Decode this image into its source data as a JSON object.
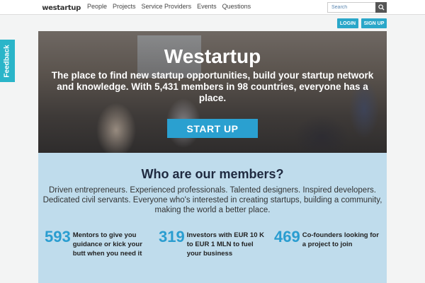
{
  "nav": {
    "logo_text": "westartup",
    "links": [
      "People",
      "Projects",
      "Service Providers",
      "Events",
      "Questions"
    ],
    "search_placeholder": "Search",
    "login_label": "LOGIN",
    "signup_label": "SIGN UP",
    "search_icon": "magnifier-icon"
  },
  "feedback": {
    "label": "Feedback"
  },
  "hero": {
    "title": "Westartup",
    "tagline": "The place to find new startup opportunities, build your startup network and knowledge. With 5,431 members in 98 countries, everyone has a place.",
    "cta_label": "START UP"
  },
  "members": {
    "title": "Who are our members?",
    "description": "Driven entrepreneurs. Experienced professionals. Talented designers. Inspired developers. Dedicated civil servants. Everyone who's interested in creating startups, building a community, making the world a better place.",
    "stats": [
      {
        "number": "593",
        "label": "Mentors to give you guidance or kick your butt when you need it"
      },
      {
        "number": "319",
        "label": "Investors with EUR 10 K to EUR 1 MLN to fuel your business"
      },
      {
        "number": "469",
        "label": "Co-founders looking for a project to join"
      }
    ]
  },
  "colors": {
    "accent": "#2aa7c9",
    "stat_number": "#2a9dd0",
    "members_bg": "#bfdcec",
    "feedback_tab": "#2ab5c9"
  }
}
